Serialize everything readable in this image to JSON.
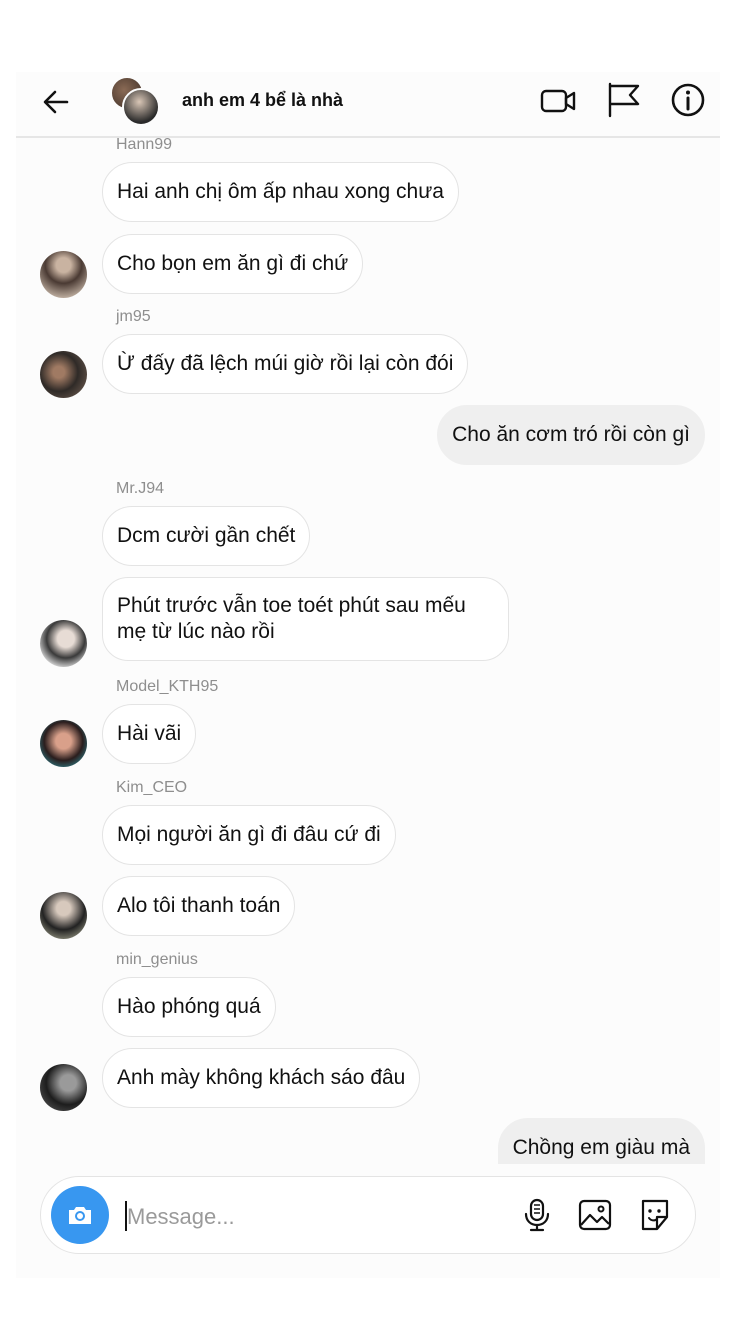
{
  "header": {
    "title": "anh em 4 bể là nhà"
  },
  "messages": [
    {
      "sender": "Hann99",
      "text": "Hai anh chị ôm ấp nhau xong chưa"
    },
    {
      "text": "Cho bọn em ăn gì đi chứ"
    },
    {
      "sender": "jm95",
      "text": "Ừ đấy đã lệch múi giờ rồi lại còn đói"
    },
    {
      "text": "Cho ăn cơm tró rồi còn gì",
      "from_me": true
    },
    {
      "sender": "Mr.J94",
      "text": "Dcm cười gần chết"
    },
    {
      "text": "Phút trước vẫn toe toét phút sau mếu mẹ từ lúc nào rồi"
    },
    {
      "sender": "Model_KTH95",
      "text": "Hài vãi"
    },
    {
      "sender": "Kim_CEO",
      "text": "Mọi người ăn gì đi đâu cứ đi"
    },
    {
      "text": "Alo tôi thanh toán"
    },
    {
      "sender": "min_genius",
      "text": "Hào phóng quá"
    },
    {
      "text": "Anh mày không khách sáo đâu"
    },
    {
      "text": "Chồng em giàu mà",
      "from_me": true
    }
  ],
  "composer": {
    "placeholder": "Message..."
  },
  "icons": {
    "back": "arrow-left-icon",
    "video": "video-camera-icon",
    "flag": "flag-icon",
    "info": "info-icon",
    "camera": "camera-icon",
    "mic": "microphone-icon",
    "gallery": "image-icon",
    "sticker": "sticker-icon"
  },
  "colors": {
    "accent": "#3897f0",
    "own_bubble": "#efefef",
    "sender_name": "#8e8e8e"
  }
}
